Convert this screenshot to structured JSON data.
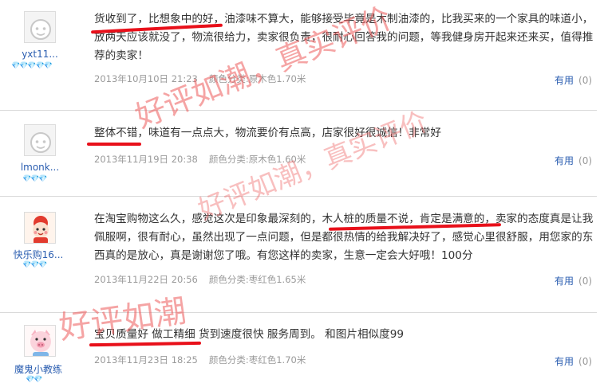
{
  "reviews": [
    {
      "username": "yxt11...",
      "content": "货收到了，比想象中的好，油漆味不算大，能够接受毕竟是木制油漆的，比我买来的一个家具的味道小，放两天应该就没了，物流很给力，卖家很负责，很耐心回答我的问题，等我健身房开起来还来买，值得推荐的卖家！",
      "date": "2013年10月10日 21:23",
      "sku": "颜色分类:原木色1.70米",
      "helpful_label": "有用",
      "helpful_count": "(0)",
      "diamonds": "💎💎💎💎💎"
    },
    {
      "username": "lmonk...",
      "content": "整体不错，味道有一点点大，物流要价有点高，店家很好很诚信！非常好",
      "date": "2013年11月19日 20:38",
      "sku": "颜色分类:原木色1.60米",
      "helpful_label": "有用",
      "helpful_count": "(0)",
      "diamonds": "💎💎💎"
    },
    {
      "username": "快乐购16...",
      "content": "在淘宝购物这么久，感觉这次是印象最深刻的，木人桩的质量不说，肯定是满意的，卖家的态度真是让我佩服啊，很有耐心，虽然出现了一点问题，但是都很热情的给我解决好了，感觉心里很舒服，用您家的东西真的是放心，真是谢谢您了哦。有您这样的卖家，生意一定会大好哦！100分",
      "date": "2013年11月22日 20:56",
      "sku": "颜色分类:枣红色1.65米",
      "helpful_label": "有用",
      "helpful_count": "(0)",
      "diamonds": "💎💎💎"
    },
    {
      "username": "魔鬼小教练",
      "content": "宝贝质量好 做工精细 货到速度很快 服务周到。 和图片相似度99",
      "date": "2013年11月23日 18:25",
      "sku": "颜色分类:枣红色1.70米",
      "helpful_label": "有用",
      "helpful_count": "(0)",
      "diamonds": "💎💎"
    }
  ],
  "watermarks": [
    "好评如潮，真实评价",
    "好评如潮，真实评价",
    "好评如潮"
  ],
  "colors": {
    "username": "#2a5db0",
    "underline": "#e8101a",
    "meta": "#9a9a9a",
    "separator": "#d9d9d9"
  }
}
